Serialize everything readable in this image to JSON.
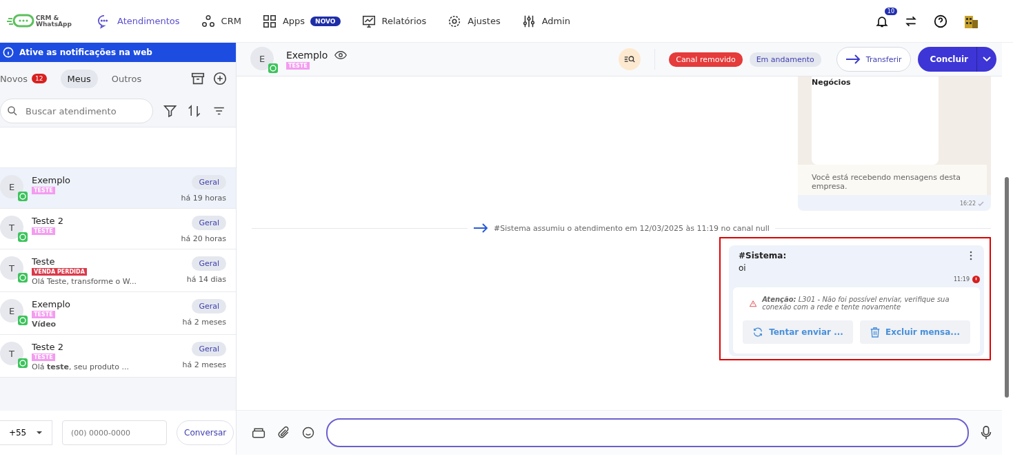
{
  "logo": {
    "text": "CRM & WhatsApp"
  },
  "nav": [
    {
      "label": "Atendimentos",
      "selected": true
    },
    {
      "label": "CRM",
      "selected": false
    },
    {
      "label": "Apps",
      "selected": false,
      "badge": "NOVO"
    },
    {
      "label": "Relatórios",
      "selected": false
    },
    {
      "label": "Ajustes",
      "selected": false
    },
    {
      "label": "Admin",
      "selected": false
    }
  ],
  "notifications": {
    "count": "10"
  },
  "banner": {
    "text": "Ative as notificações na web"
  },
  "tabs": [
    {
      "label": "Novos",
      "badge": "12",
      "selected": false
    },
    {
      "label": "Meus",
      "selected": true
    },
    {
      "label": "Outros",
      "selected": false
    }
  ],
  "search": {
    "placeholder": "Buscar atendimento"
  },
  "conversations": [
    {
      "initial": "E",
      "name": "Exemplo",
      "tag": "TESTE",
      "color": "#f39cf0",
      "queue": "Geral",
      "time": "há 19 horas",
      "selected": true
    },
    {
      "initial": "T",
      "name": "Teste 2",
      "tag": "TESTE",
      "color": "#f39cf0",
      "queue": "Geral",
      "time": "há 20 horas",
      "selected": false
    },
    {
      "initial": "T",
      "name": "Teste",
      "tag": "VENDA PERDIDA",
      "color": "#d93a4a",
      "preview": "Olá Teste, transforme o W...",
      "preview_bold": false,
      "queue": "Geral",
      "time": "há 14 dias",
      "selected": false
    },
    {
      "initial": "E",
      "name": "Exemplo",
      "tag": "TESTE",
      "color": "#f39cf0",
      "preview": "Vídeo",
      "preview_bold": true,
      "queue": "Geral",
      "time": "há 2 meses",
      "selected": false
    },
    {
      "initial": "T",
      "name": "Teste 2",
      "tag": "TESTE",
      "color": "#f39cf0",
      "preview": "Olá **teste**, seu produto ...",
      "preview_bold": false,
      "queue": "Geral",
      "time": "há 2 meses",
      "selected": false
    }
  ],
  "new_chat": {
    "country_code": "+55",
    "phone_placeholder": "(00) 0000-0000",
    "button": "Conversar"
  },
  "chat_header": {
    "initial": "E",
    "name": "Exemplo",
    "tag": "TESTE",
    "status_badges": [
      {
        "label": "Canal removido",
        "kind": "danger"
      },
      {
        "label": "Em andamento",
        "kind": "info"
      }
    ],
    "transfer": "Transferir",
    "conclude": "Concluir"
  },
  "messages": [
    {
      "kind": "template",
      "title": "Negócios",
      "footer": "Você está recebendo mensagens desta empresa.",
      "time": "16:22"
    },
    {
      "kind": "event",
      "text": "#Sistema assumiu o atendimento em 12/03/2025 às 11:19 no canal null"
    },
    {
      "kind": "failed",
      "author": "#Sistema:",
      "text": "oi",
      "time": "11:19",
      "warning": "**Atenção:** L301 - Não foi possível enviar, verifique sua conexão com a rede e tente novamente",
      "retry": "Tentar enviar ...",
      "delete": "Excluir mensa..."
    }
  ]
}
